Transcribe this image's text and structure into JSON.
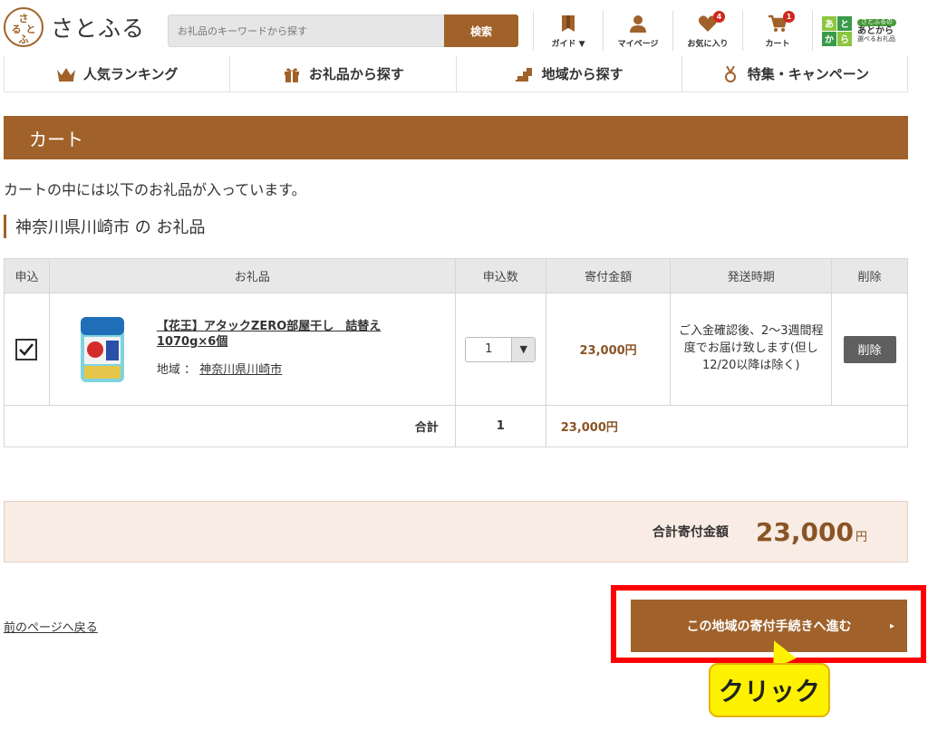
{
  "header": {
    "logo_mark": "さ\nると\nふ",
    "logo_text": "さとふる",
    "search_placeholder": "お礼品のキーワードから探す",
    "search_button": "検索",
    "icons": [
      {
        "label": "ガイド ▼",
        "icon": "book-icon"
      },
      {
        "label": "マイページ",
        "icon": "user-icon"
      },
      {
        "label": "お気に入り",
        "icon": "heart-icon",
        "badge": "4"
      },
      {
        "label": "カート",
        "icon": "cart-icon",
        "badge": "1"
      }
    ],
    "atokara": {
      "chars": [
        "あ",
        "と",
        "か",
        "ら"
      ],
      "tag": "さとふるの",
      "line1": "あとから",
      "line2": "選べるお礼品"
    }
  },
  "nav": {
    "items": [
      {
        "label": "人気ランキング",
        "icon": "crown-icon"
      },
      {
        "label": "お礼品から探す",
        "icon": "gift-icon"
      },
      {
        "label": "地域から探す",
        "icon": "region-icon"
      },
      {
        "label": "特集・キャンペーン",
        "icon": "medal-icon"
      }
    ]
  },
  "page": {
    "title": "カート",
    "intro": "カートの中には以下のお礼品が入っています。",
    "region_heading": "神奈川県川崎市 の お礼品"
  },
  "table": {
    "headers": [
      "申込",
      "お礼品",
      "申込数",
      "寄付金額",
      "発送時期",
      "削除"
    ],
    "item": {
      "name": "【花王】アタックZERO部屋干し　詰替え1070g×6個",
      "area_label": "地域 ：",
      "area_link": "神奈川県川崎市",
      "quantity": "1",
      "amount": "23,000円",
      "shipping": "ご入金確認後、2～3週間程度でお届け致します(但し12/20以降は除く)",
      "delete_label": "削除"
    },
    "total": {
      "label": "合計",
      "quantity": "1",
      "amount": "23,000円"
    }
  },
  "summary": {
    "label": "合計寄付金額",
    "amount": "23,000",
    "unit": "円"
  },
  "footer": {
    "back_link": "前のページへ戻る",
    "proceed_button": "この地域の寄付手続きへ進む",
    "proceed_arrow": "▸",
    "callout": "クリック"
  },
  "colors": {
    "brand": "#a0622a",
    "highlight": "#ff0000",
    "callout": "#fff200"
  }
}
